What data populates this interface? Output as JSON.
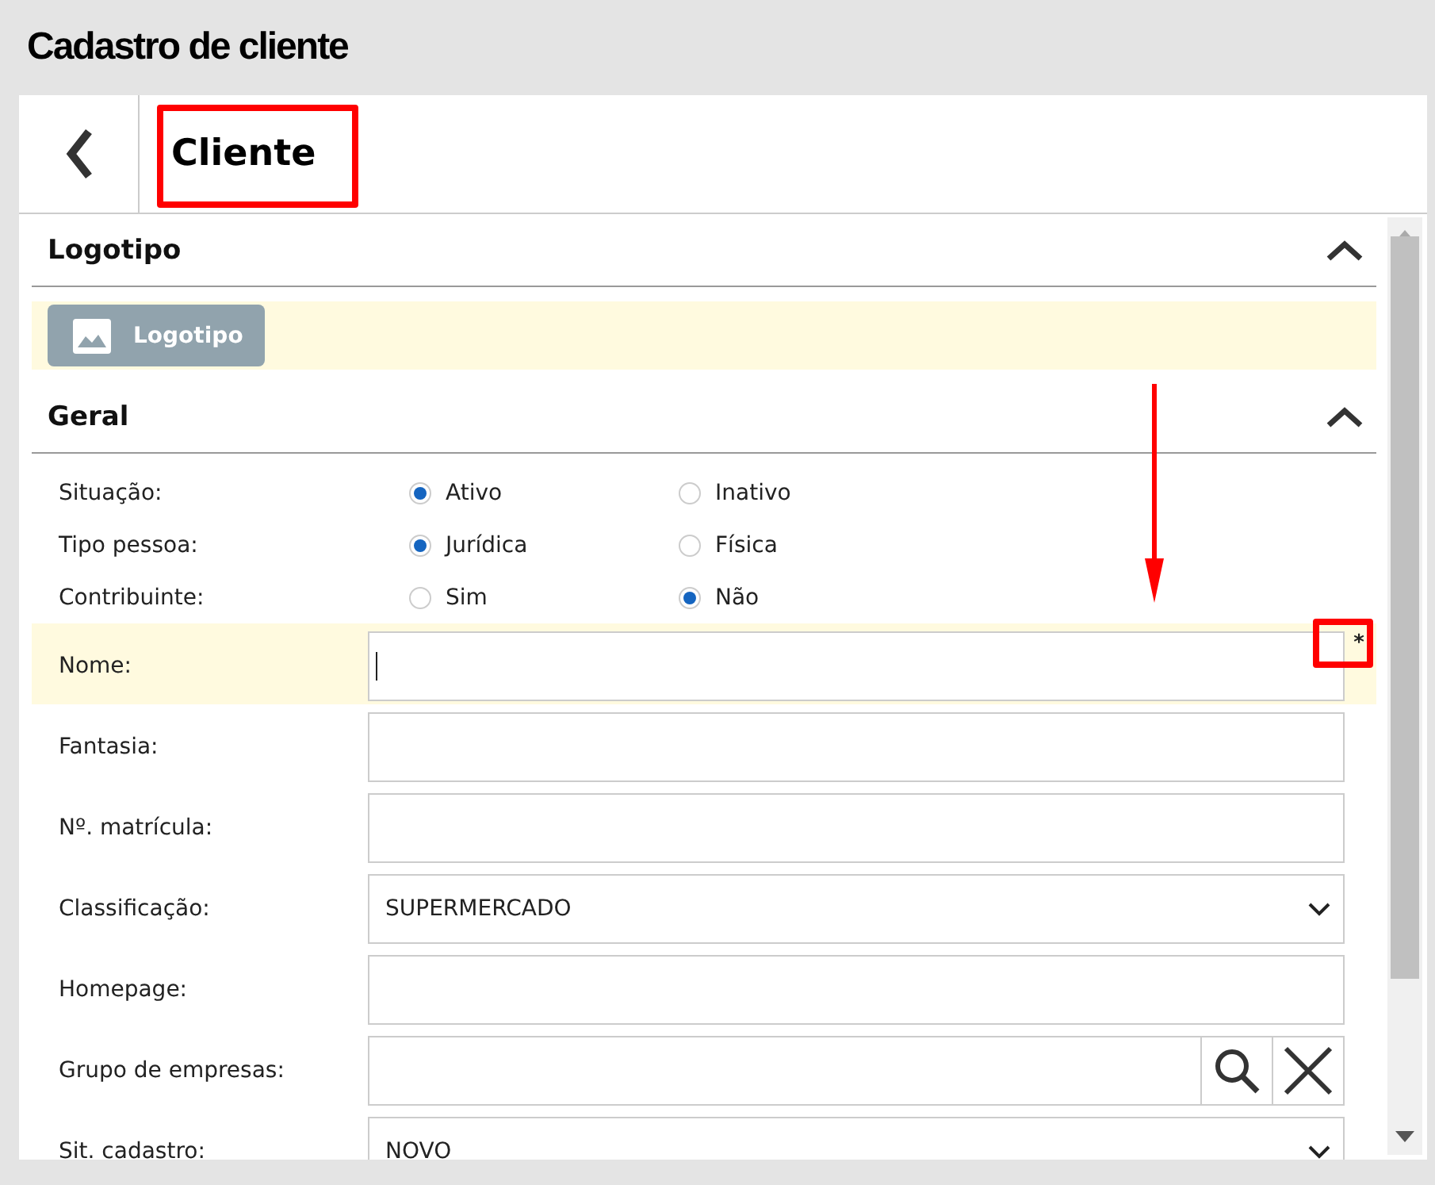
{
  "page_title": "Cadastro de cliente",
  "header": {
    "title": "Cliente"
  },
  "sections": [
    {
      "kind": "logo",
      "title": "Logotipo",
      "expanded": true,
      "button": "Logotipo"
    },
    {
      "kind": "form",
      "title": "Geral",
      "expanded": true,
      "radio_groups": [
        {
          "label": "Situação:",
          "options": [
            {
              "label": "Ativo",
              "selected": true
            },
            {
              "label": "Inativo",
              "selected": false
            }
          ]
        },
        {
          "label": "Tipo pessoa:",
          "options": [
            {
              "label": "Jurídica",
              "selected": true
            },
            {
              "label": "Física",
              "selected": false
            }
          ]
        },
        {
          "label": "Contribuinte:",
          "options": [
            {
              "label": "Sim",
              "selected": false
            },
            {
              "label": "Não",
              "selected": true
            }
          ]
        }
      ],
      "fields": [
        {
          "kind": "text",
          "label": "Nome:",
          "focused": true,
          "marker": "*"
        },
        {
          "kind": "text",
          "label": "Fantasia:",
          "focused": false
        },
        {
          "kind": "text",
          "label": "Nº. matrícula:",
          "focused": false
        },
        {
          "kind": "select",
          "label": "Classificação:",
          "value": "SUPERMERCADO",
          "focused": false
        },
        {
          "kind": "text",
          "label": "Homepage:",
          "focused": false
        },
        {
          "kind": "lookup",
          "label": "Grupo de empresas:",
          "focused": false
        },
        {
          "kind": "select",
          "label": "Sit. cadastro:",
          "value": "NOVO",
          "focused": false
        }
      ]
    }
  ]
}
